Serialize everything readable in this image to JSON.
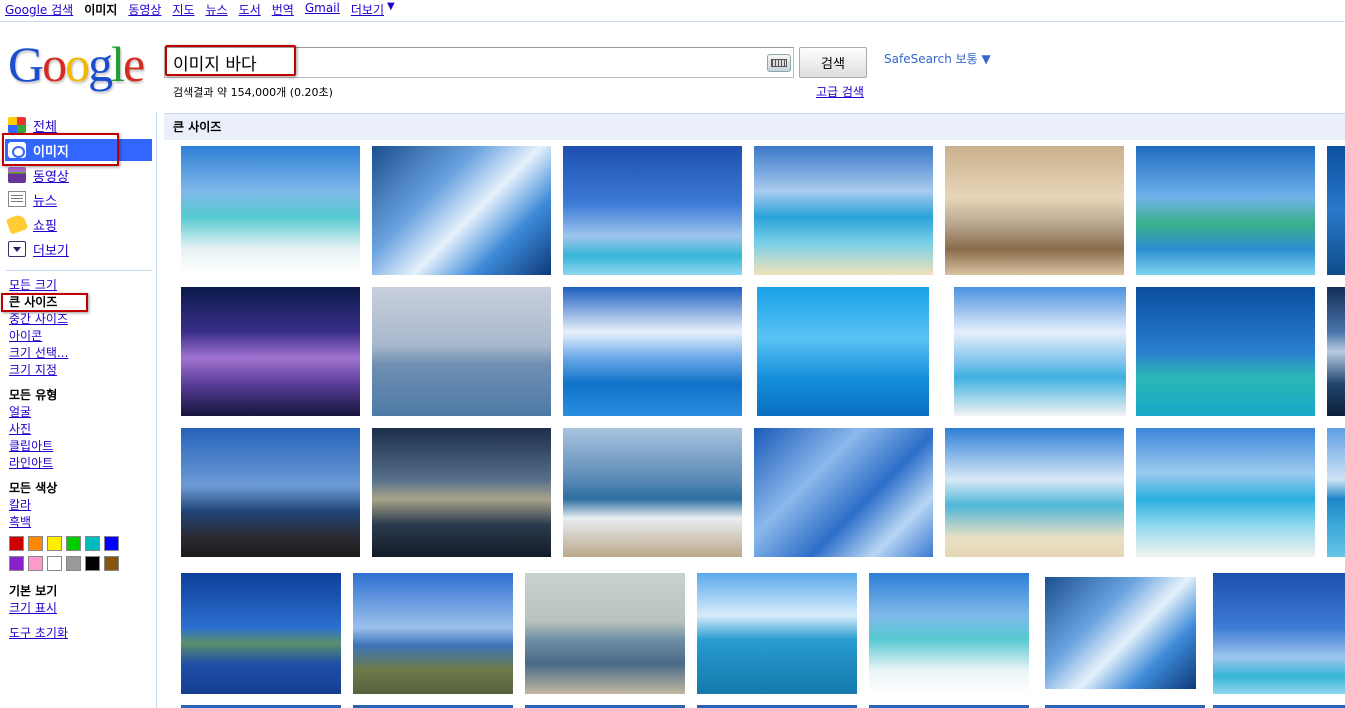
{
  "topnav": {
    "items": [
      "Google 검색",
      "이미지",
      "동영상",
      "지도",
      "뉴스",
      "도서",
      "번역",
      "Gmail",
      "더보기"
    ],
    "active_index": 1,
    "more_arrow": "▼"
  },
  "logo": {
    "letters": [
      "G",
      "o",
      "o",
      "g",
      "l",
      "e"
    ],
    "colors": [
      "#1a4ecf",
      "#d62b1f",
      "#f1b900",
      "#1a4ecf",
      "#1e9e33",
      "#d62b1f"
    ]
  },
  "search": {
    "query": "이미지 바다",
    "button_label": "검색",
    "safesearch_label": "SafeSearch 보통 ▼",
    "result_stats": "검색결과 약 154,000개 (0.20초)",
    "advanced_label": "고급 검색"
  },
  "sidebar": {
    "nav": [
      {
        "label": "전체",
        "icon": "web-icon",
        "selected": false
      },
      {
        "label": "이미지",
        "icon": "images-icon",
        "selected": true
      },
      {
        "label": "동영상",
        "icon": "video-icon",
        "selected": false
      },
      {
        "label": "뉴스",
        "icon": "news-icon",
        "selected": false
      },
      {
        "label": "쇼핑",
        "icon": "shopping-icon",
        "selected": false
      },
      {
        "label": "더보기",
        "icon": "more-icon",
        "selected": false
      }
    ],
    "size_filters": [
      "모든 크기",
      "큰 사이즈",
      "중간 사이즈",
      "아이콘",
      "크기 선택...",
      "크기 지정"
    ],
    "size_selected": 1,
    "type_heading": "모든 유형",
    "type_filters": [
      "얼굴",
      "사진",
      "클립아트",
      "라인아트"
    ],
    "color_heading": "모든 색상",
    "color_filters": [
      "칼라",
      "흑백"
    ],
    "color_swatches_row1": [
      "#cc0000",
      "#ff8800",
      "#ffee00",
      "#00cc00",
      "#00bbbb",
      "#0000ff"
    ],
    "color_swatches_row2": [
      "#8822cc",
      "#ff99cc",
      "#ffffff",
      "#999999",
      "#000000",
      "#885511"
    ],
    "view_heading": "기본 보기",
    "view_link": "크기 표시",
    "reset_link": "도구 초기화"
  },
  "main": {
    "section_title": "큰 사이즈",
    "thumbnail_gradients": [
      "linear-gradient(#2e7fd6 0%, #7fb8ea 35%, #56c9d0 55%, #e8f3f5 80%, #ffffff 100%)",
      "linear-gradient(135deg, #1b4f8f 0%, #6aa3df 35%, #e6f1fb 55%, #3d8ad8 75%, #0e3a7a 100%)",
      "linear-gradient(#1d4fae 0%, #3d7bd6 45%, #9ec6ee 70%, #37b5d6 85%, #8ed6f0 100%)",
      "linear-gradient(#3c78c8 0%, #a9cbef 35%, #2aa2d9 55%, #79cfe8 75%, #f1e2b9 100%)",
      "linear-gradient(#c9b08c 0%, #e8d6b9 40%, #b9a890 60%, #8a6b4a 80%, #d9c2a0 100%)",
      "linear-gradient(#1f6bc0 0%, #6fb2ea 40%, #3bb08a 60%, #2c8fd0 80%, #7fd4ee 100%)",
      "linear-gradient(#0c4fa0 0%, #2a78c9 50%, #0e4d8a 100%)",
      "linear-gradient(#0b1a4a 0%, #3a2f8a 35%, #a073d0 55%, #5a3e9a 75%, #15143a 100%)",
      "linear-gradient(#c8cfdc 0%, #a8b8cc 45%, #6f8fb2 60%, #4d7aa6 100%)",
      "linear-gradient(#1c5fc0 0%, #e8f1fb 35%, #6aa8e8 55%, #0f72c8 75%, #2a8ee0 100%)",
      "linear-gradient(#1aa0e8 0%, #59c3f4 40%, #1690dc 70%, #0b6fc0 100%)",
      "linear-gradient(#4a92e0 0%, #e6f0fb 35%, #8ec9ef 55%, #3fb0e0 70%, #f1f4f2 100%)",
      "linear-gradient(#0a4d9e 0%, #2a7ed0 50%, #2bb7b4 70%, #16a8c8 100%)",
      "linear-gradient(#132e58 0%, #4a75aa 35%, #b8cce2 50%, #22466f 75%, #0a1e3a 100%)",
      "linear-gradient(#2563b8 0%, #6d9bd6 45%, #1f4476 65%, #2a2a30 85%, #1b1b1e 100%)",
      "linear-gradient(#1d2f4a 0%, #556e8a 40%, #a8a48a 55%, #2b3a4d 75%, #121b28 100%)",
      "linear-gradient(#a9c4de 0%, #5a8ab8 40%, #2c6ea0 55%, #e8eef2 70%, #bca78a 100%)",
      "linear-gradient(135deg, #1a5ab8 0%, #8cb8ec 35%, #2c6ec8 60%, #b8d6f4 80%, #3a78d0 100%)",
      "linear-gradient(#2e7fd6 0%, #d9e9f7 40%, #4fb6d8 60%, #e9e0c4 85%, #e6d7b5 100%)",
      "linear-gradient(#3b86d8 0%, #9ccaf0 35%, #2ab0de 55%, #8fd8ee 75%, #f4f4f0 100%)",
      "linear-gradient(#5fa0e4 0%, #cfe3f5 40%, #1e86c8 55%, #3aa8d8 75%, #66c4e6 100%)",
      "linear-gradient(#0e3f9a 0%, #2c6fd0 45%, #5a8f6a 58%, #1f4fa8 75%, #143d90 100%)",
      "linear-gradient(#2f6fd0 0%, #9cc0ec 45%, #3d74b8 60%, #6e7a48 80%, #56623c 100%)",
      "linear-gradient(#c9d2cf 0%, #b9c2bd 40%, #6f8ea6 55%, #4a6a88 75%, #c2b8a2 100%)",
      "linear-gradient(#5aa8ec 0%, #d8ecfa 35%, #2a9cd2 55%, #1c88bc 80%, #157aab 100%)"
    ]
  }
}
